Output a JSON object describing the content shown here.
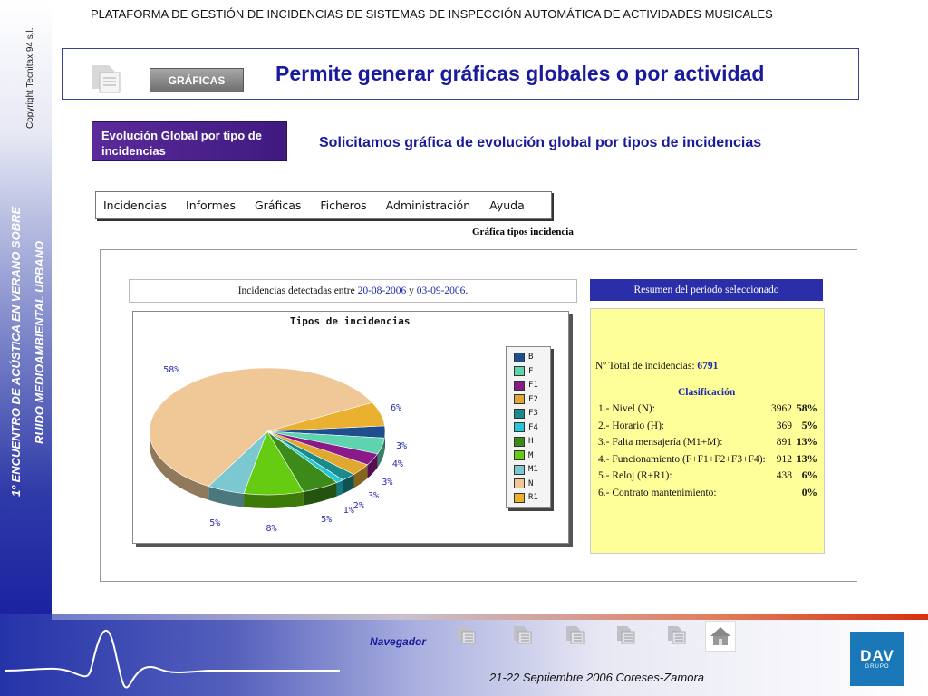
{
  "platform_title": "PLATAFORMA DE GESTIÓN DE INCIDENCIAS DE SISTEMAS DE INSPECCIÓN AUTOMÁTICA DE ACTIVIDADES MUSICALES",
  "copyright": "Copyright Tecnitax 94 s.l.",
  "side_title_1": "1º ENCUENTRO DE ACÚSTICA EN VERANO SOBRE",
  "side_title_2": "RUIDO MEDIOAMBIENTAL URBANO",
  "header": {
    "button_label": "GRÁFICAS",
    "title": "Permite generar gráficas globales o por actividad"
  },
  "evolution_box": "Evolución Global  por tipo de incidencias",
  "request_text": "Solicitamos gráfica de evolución global por tipos de incidencias",
  "menu": [
    "Incidencias",
    "Informes",
    "Gráficas",
    "Ficheros",
    "Administración",
    "Ayuda"
  ],
  "chart_page_title": "Gráfica tipos incidencia",
  "dates": {
    "prefix": "Incidencias detectadas entre",
    "from": "20-08-2006",
    "conj": "y",
    "to": "03-09-2006",
    "suffix": "."
  },
  "summary": {
    "header": "Resumen del periodo seleccionado",
    "total_label": "Nº Total de incidencias:",
    "total_value": "6791",
    "clasif_label": "Clasificación",
    "rows": [
      {
        "label": "1.- Nivel (N):",
        "value": "3962",
        "pct": "58%"
      },
      {
        "label": "2.- Horario (H):",
        "value": "369",
        "pct": "5%"
      },
      {
        "label": "3.- Falta mensajería (M1+M):",
        "value": "891",
        "pct": "13%"
      },
      {
        "label": "4.- Funcionamiento (F+F1+F2+F3+F4):",
        "value": "912",
        "pct": "13%"
      },
      {
        "label": "5.- Reloj (R+R1):",
        "value": "438",
        "pct": "6%"
      },
      {
        "label": "6.- Contrato mantenimiento:",
        "value": "",
        "pct": "0%"
      }
    ]
  },
  "footer": {
    "navegador": "Navegador",
    "date": "21-22 Septiembre 2006 Coreses-Zamora",
    "logo_main": "DAV",
    "logo_sub": "GRUPO"
  },
  "icons": [
    "document-stack-icon",
    "home-icon"
  ],
  "chart_data": {
    "type": "pie",
    "title": "Tipos de incidencias",
    "categories": [
      "B",
      "F",
      "F1",
      "F2",
      "F3",
      "F4",
      "H",
      "M",
      "M1",
      "N",
      "R1"
    ],
    "values": [
      3,
      4,
      3,
      3,
      2,
      1,
      5,
      8,
      5,
      58,
      6
    ],
    "labels": [
      "3%",
      "4%",
      "3%",
      "3%",
      "2%",
      "1%",
      "5%",
      "8%",
      "5%",
      "58%",
      "6%"
    ],
    "colors": [
      "#1f4e8c",
      "#5ed3b0",
      "#8a1a8a",
      "#e0a830",
      "#1a8a8a",
      "#22c8d8",
      "#3c8a1a",
      "#66cc11",
      "#7cc8d0",
      "#f0c898",
      "#eab030"
    ],
    "legend": "right"
  }
}
